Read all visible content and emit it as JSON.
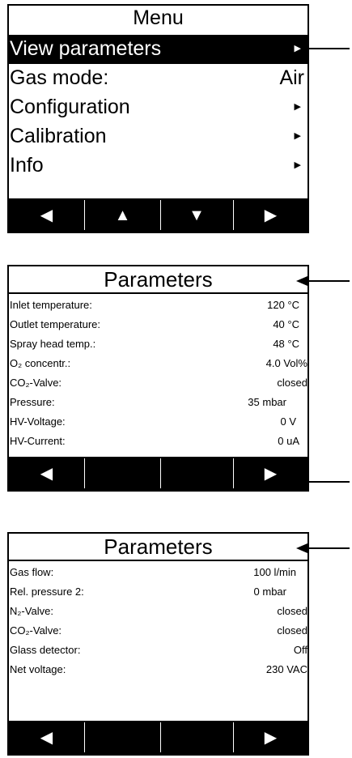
{
  "menu_screen": {
    "title": "Menu",
    "items": [
      {
        "label": "View parameters",
        "value": "",
        "arrow": "▶"
      },
      {
        "label": "Gas mode:",
        "value": "Air",
        "arrow": ""
      },
      {
        "label": "Configuration",
        "value": "",
        "arrow": "▶"
      },
      {
        "label": "Calibration",
        "value": "",
        "arrow": "▶"
      },
      {
        "label": "Info",
        "value": "",
        "arrow": "▶"
      }
    ],
    "softkeys": [
      "◀",
      "▲",
      "▼",
      "▶"
    ]
  },
  "parameters_screen_1": {
    "title": "Parameters",
    "rows": [
      {
        "label": "Inlet temperature:",
        "value": "120 °C"
      },
      {
        "label": "Outlet temperature:",
        "value": "40 °C"
      },
      {
        "label": "Spray head temp.:",
        "value": "48 °C"
      },
      {
        "label": "O₂ concentr.:",
        "value": "4.0  Vol%"
      },
      {
        "label": "CO₂-Valve:",
        "value": "closed"
      },
      {
        "label": "Pressure:",
        "value": "35 mbar"
      },
      {
        "label": "HV-Voltage:",
        "value": "0  V"
      },
      {
        "label": "HV-Current:",
        "value": "0  uA"
      }
    ],
    "softkeys": [
      "◀",
      "",
      "",
      "▶"
    ]
  },
  "parameters_screen_2": {
    "title": "Parameters",
    "rows": [
      {
        "label": "Gas flow:",
        "value": "100 l/min"
      },
      {
        "label": "Rel. pressure 2:",
        "value": "0 mbar"
      },
      {
        "label": "N₂-Valve:",
        "value": "closed"
      },
      {
        "label": "CO₂-Valve:",
        "value": "closed"
      },
      {
        "label": "Glass detector:",
        "value": "Off"
      },
      {
        "label": "Net voltage:",
        "value": "230 VAC"
      }
    ],
    "softkeys": [
      "◀",
      "",
      "",
      "▶"
    ]
  }
}
